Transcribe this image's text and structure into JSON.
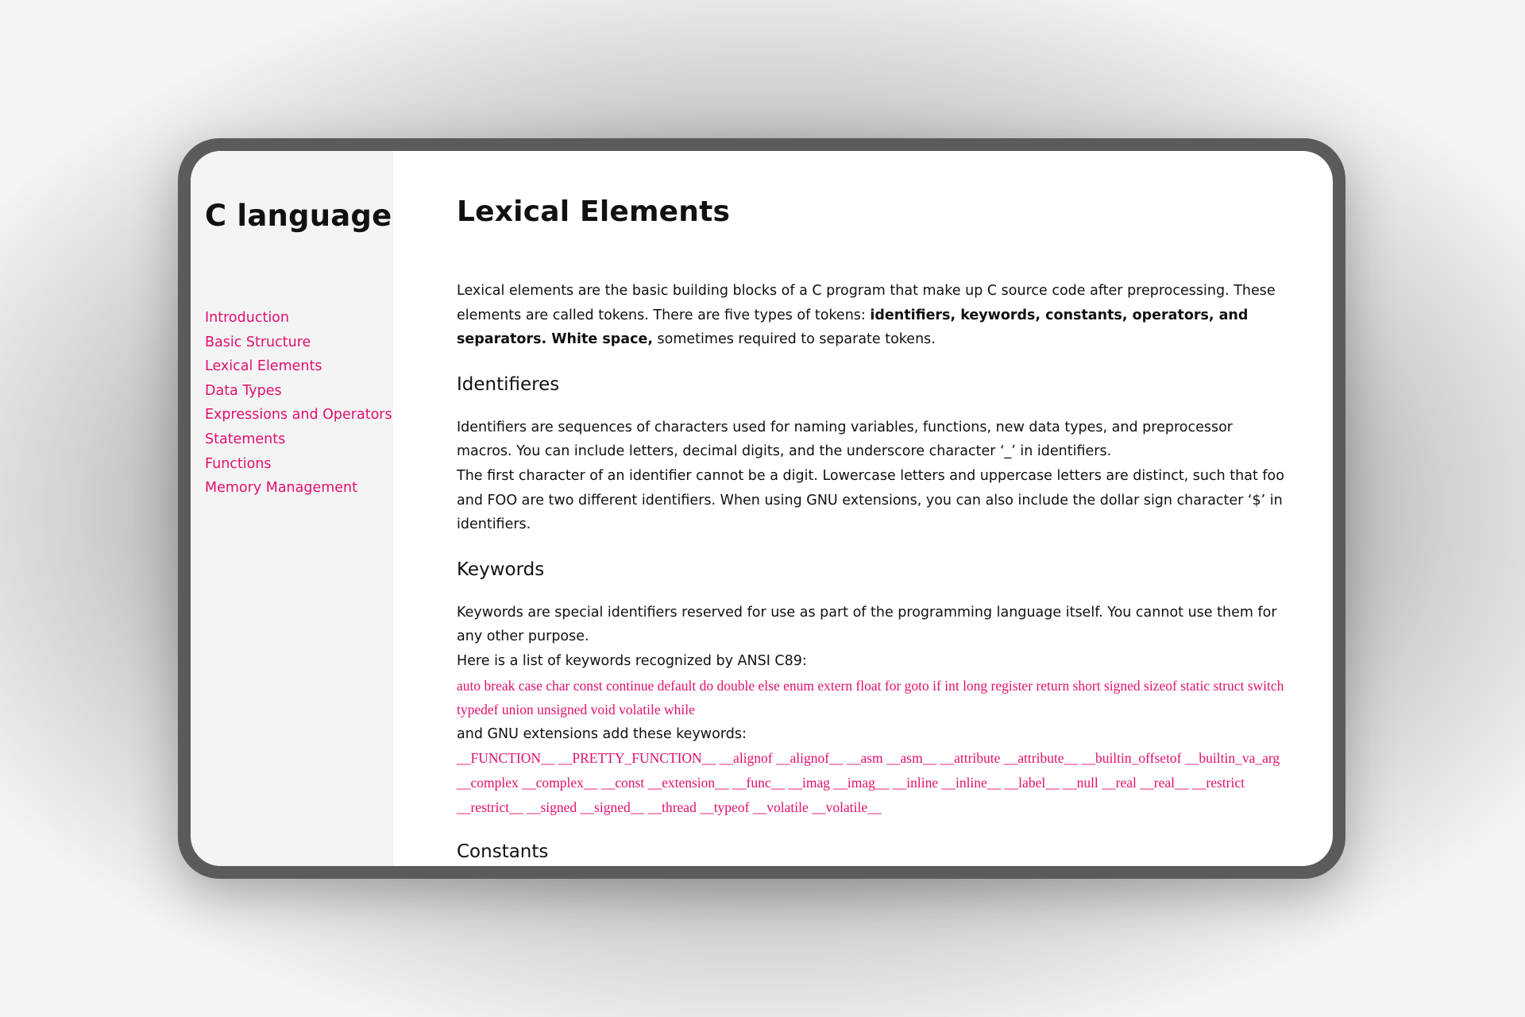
{
  "sidebar": {
    "title": "C language",
    "items": [
      {
        "label": "Introduction"
      },
      {
        "label": "Basic Structure"
      },
      {
        "label": "Lexical Elements"
      },
      {
        "label": "Data Types"
      },
      {
        "label": "Expressions and Operators"
      },
      {
        "label": "Statements"
      },
      {
        "label": "Functions"
      },
      {
        "label": "Memory Management"
      }
    ]
  },
  "main": {
    "title": "Lexical Elements",
    "intro_part1": "Lexical elements are the basic building blocks of a C program that make up C source code after preprocessing. These elements are called tokens. There are five types of tokens: ",
    "intro_bold": "identifiers, keywords, constants, operators, and separators. White space,",
    "intro_part2": " sometimes required to separate tokens.",
    "identifiers": {
      "heading": "Identifieres",
      "para1": "Identifiers are sequences of characters used for naming variables, functions, new data types, and preprocessor macros. You can include letters, decimal digits, and the underscore character ‘_’ in identifiers.",
      "para2": "The first character of an identifier cannot be a digit. Lowercase letters and uppercase letters are distinct, such that foo and FOO are two different identifiers. When using GNU extensions, you can also include the dollar sign character ‘$’ in identifiers."
    },
    "keywords": {
      "heading": "Keywords",
      "para1": "Keywords are special identifiers reserved for use as part of the programming language itself. You cannot use them for any other purpose.",
      "ansi_intro": "Here is a list of keywords recognized by ANSI C89:",
      "ansi_list": "auto break case char const continue default do double else enum extern float for goto if int long register return short signed sizeof static struct switch typedef union unsigned void volatile while",
      "gnu_intro": "and GNU extensions add these keywords:",
      "gnu_list": "__FUNCTION__ __PRETTY_FUNCTION__ __alignof __alignof__ __asm __asm__ __attribute __attribute__ __builtin_offsetof __builtin_va_arg __complex __complex__ __const __extension__ __func__ __imag __imag__ __inline __inline__ __label__ __null __real __real__ __restrict __restrict__ __signed __signed__ __thread __typeof __volatile __volatile__"
    },
    "constants": {
      "heading": "Constants"
    }
  },
  "colors": {
    "accent": "#e0106e",
    "sidebar_bg": "#f4f4f4",
    "frame": "#5b5b5b"
  }
}
